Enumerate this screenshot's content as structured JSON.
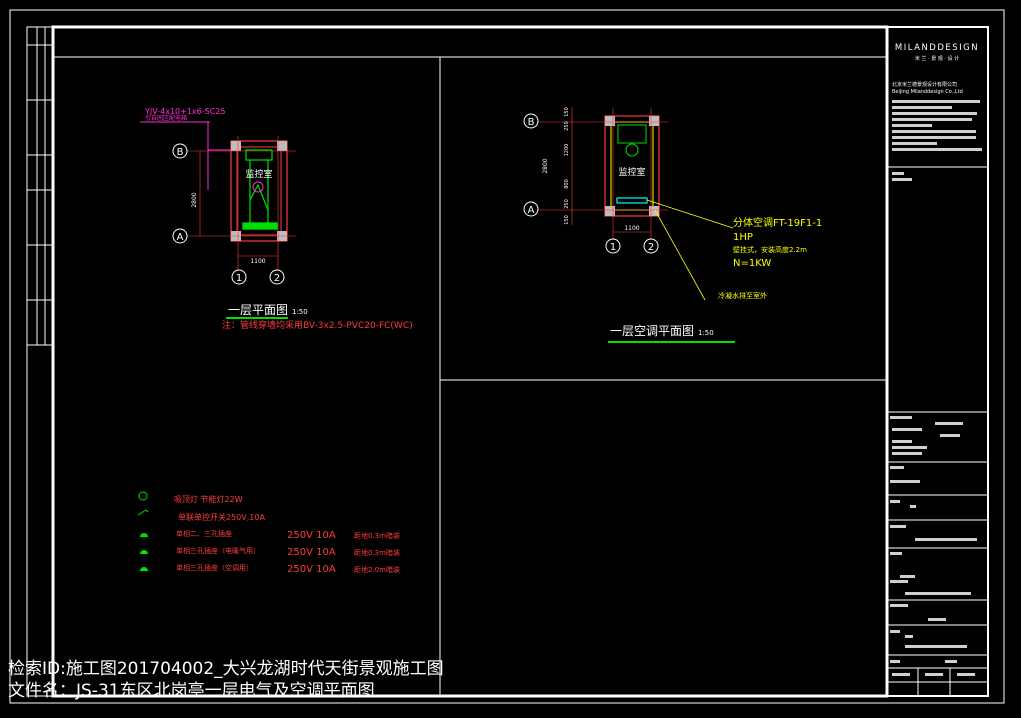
{
  "title_block": {
    "company_logo_text": "MILANDDESIGN",
    "company_logo_sub": "米 兰 · 景 观 · 设 计",
    "company_name_cn": "北京米兰德景观设计有限公司",
    "company_name_en": "Beijing Milanddesign Co.,Ltd"
  },
  "plan_left": {
    "title": "一层平面图",
    "scale": "1:50",
    "note": "注：管线穿墙均采用BV-3x2.5-PVC20-FC(WC)",
    "room_label": "监控室",
    "cable_label": "YJV-4x10+1x6-SC25",
    "cable_sub": "引自园区配电箱",
    "dim_width": "1100",
    "dim_height": "2800",
    "axis_a": "A",
    "axis_b": "B",
    "axis_1": "1",
    "axis_2": "2"
  },
  "plan_right": {
    "title": "一层空调平面图",
    "scale": "1:50",
    "room_label": "监控室",
    "unit_model": "分体空调FT-19F1-1",
    "unit_type": "1HP",
    "unit_note": "壁挂式，安装高度2.2m",
    "unit_power": "N=1KW",
    "pipe_note": "冷凝水排至室外",
    "dim_width": "1100",
    "dim_height": "2800",
    "dim_segments": [
      "150",
      "250",
      "1200",
      "800",
      "250",
      "150"
    ],
    "axis_a": "A",
    "axis_b": "B",
    "axis_1": "1",
    "axis_2": "2"
  },
  "legend": {
    "rows": [
      {
        "desc": "吸顶灯 节能灯22W",
        "rating": "",
        "height": ""
      },
      {
        "desc": "单联单控开关250V,10A",
        "rating": "",
        "height": ""
      },
      {
        "desc": "单相二、三孔插座",
        "rating": "250V 10A",
        "height": "距地0.3m暗装"
      },
      {
        "desc": "单相三孔插座（电暖气用）",
        "rating": "250V 10A",
        "height": "距地0.3m暗装"
      },
      {
        "desc": "单相三孔插座（空调用）",
        "rating": "250V 10A",
        "height": "距地2.0m暗装"
      }
    ]
  },
  "footer": {
    "line1": "检索ID:施工图201704002_大兴龙湖时代天街景观施工图",
    "line2": "文件名：JS-31东区北岗亭一层电气及空调平面图"
  },
  "colors": {
    "frame": "#ffffff",
    "wall": "#ff3b3b",
    "magenta": "#ff2bd6",
    "green": "#00e000",
    "yellow": "#ffff00",
    "cyan": "#00ffff",
    "grey": "#cfcfcf"
  }
}
